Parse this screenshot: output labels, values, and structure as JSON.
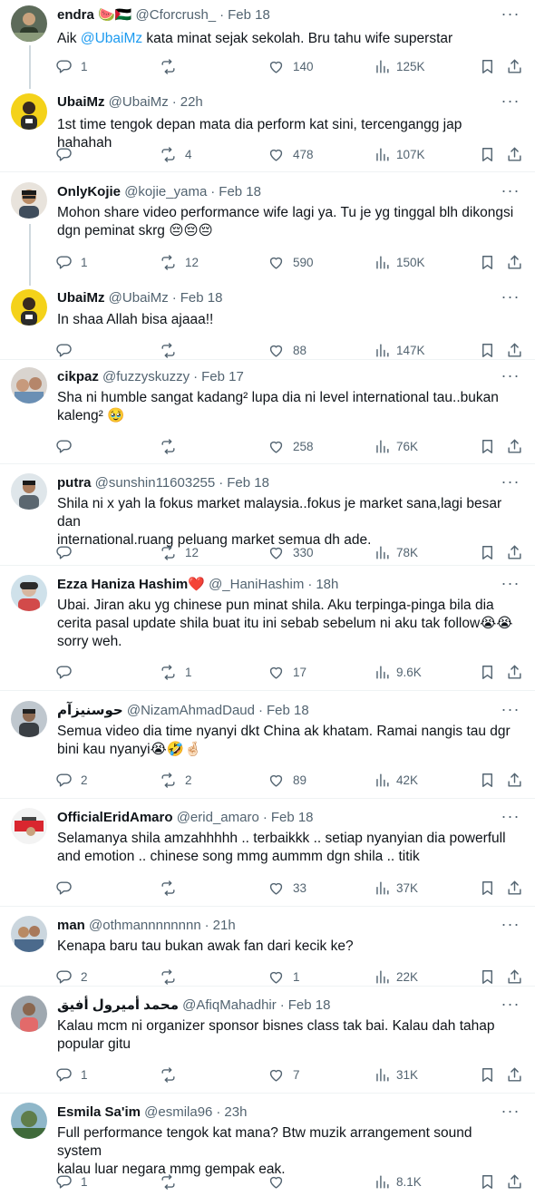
{
  "tweets": [
    {
      "name": "endra 🍉🇵🇸",
      "handle": "@Cforcrush_",
      "time": "Feb 18",
      "text": "",
      "mention": "@UbaiMz",
      "text_before": "Aik ",
      "text_after": " kata minat sejak sekolah. Bru tahu wife superstar",
      "reply": "1",
      "retweet": "",
      "like": "140",
      "views": "125K"
    },
    {
      "name": "UbaiMz",
      "handle": "@UbaiMz",
      "time": "22h",
      "text": "1st time tengok depan mata dia perform kat sini, tercengangg jap hahahah",
      "reply": "",
      "retweet": "4",
      "like": "478",
      "views": "107K"
    },
    {
      "name": "OnlyKojie",
      "handle": "@kojie_yama",
      "time": "Feb 18",
      "text": "Mohon share video performance wife lagi ya. Tu je yg tinggal blh dikongsi\ndgn peminat skrg 😔😔😔",
      "reply": "1",
      "retweet": "12",
      "like": "590",
      "views": "150K"
    },
    {
      "name": "UbaiMz",
      "handle": "@UbaiMz",
      "time": "Feb 18",
      "text": "In shaa Allah bisa ajaaa!!",
      "reply": "",
      "retweet": "",
      "like": "88",
      "views": "147K"
    },
    {
      "name": "cikpaz",
      "handle": "@fuzzyskuzzy",
      "time": "Feb 17",
      "text": "Sha ni humble sangat kadang² lupa dia ni level international tau..bukan\nkaleng² 🥹",
      "reply": "",
      "retweet": "",
      "like": "258",
      "views": "76K"
    },
    {
      "name": "putra",
      "handle": "@sunshin11603255",
      "time": "Feb 18",
      "text": "Shila ni x yah la fokus market malaysia..fokus je market sana,lagi besar dan\ninternational.ruang peluang market semua dh ade.",
      "reply": "",
      "retweet": "12",
      "like": "330",
      "views": "78K"
    },
    {
      "name": "Ezza Haniza Hashim❤️",
      "handle": "@_HaniHashim",
      "time": "18h",
      "text": "Ubai. Jiran aku yg chinese pun minat shila. Aku terpinga-pinga bila dia\ncerita pasal update shila buat itu ini  sebab sebelum ni aku tak follow😭😭\nsorry weh.",
      "reply": "",
      "retweet": "1",
      "like": "17",
      "views": "9.6K"
    },
    {
      "name": "حوسنيزآم",
      "handle": "@NizamAhmadDaud",
      "time": "Feb 18",
      "text": "Semua video dia time nyanyi dkt China ak khatam. Ramai nangis tau dgr\nbini kau nyanyi😭🤣🤞🏻",
      "reply": "2",
      "retweet": "2",
      "like": "89",
      "views": "42K"
    },
    {
      "name": "OfficialEridAmaro",
      "handle": "@erid_amaro",
      "time": "Feb 18",
      "text": "Selamanya shila amzahhhhh .. terbaikkk .. setiap nyanyian dia powerfull\nand emotion .. chinese song mmg aummm dgn shila .. titik",
      "reply": "",
      "retweet": "",
      "like": "33",
      "views": "37K"
    },
    {
      "name": "man",
      "handle": "@othmannnnnnnn",
      "time": "21h",
      "text": "Kenapa baru tau bukan awak fan dari kecik ke?",
      "reply": "2",
      "retweet": "",
      "like": "1",
      "views": "22K"
    },
    {
      "name": "محمد أميرول أفيق",
      "handle": "@AfiqMahadhir",
      "time": "Feb 18",
      "text": "Kalau mcm ni organizer sponsor bisnes class tak bai. Kalau dah tahap\npopular gitu",
      "reply": "1",
      "retweet": "",
      "like": "7",
      "views": "31K"
    },
    {
      "name": "Esmila Sa'im",
      "handle": "@esmila96",
      "time": "23h",
      "text": "Full performance tengok kat mana? Btw muzik arrangement sound system\nkalau luar negara mmg gempak eak.",
      "reply": "1",
      "retweet": "",
      "like": "",
      "views": "8.1K"
    }
  ],
  "separator": "·",
  "colors": {
    "accent": "#1d9bf0",
    "meta": "#536471",
    "divider": "#eff3f4",
    "thread": "#cfd9de"
  },
  "icons": [
    "more-icon",
    "reply-icon",
    "retweet-icon",
    "like-icon",
    "views-icon",
    "bookmark-icon",
    "share-icon"
  ]
}
